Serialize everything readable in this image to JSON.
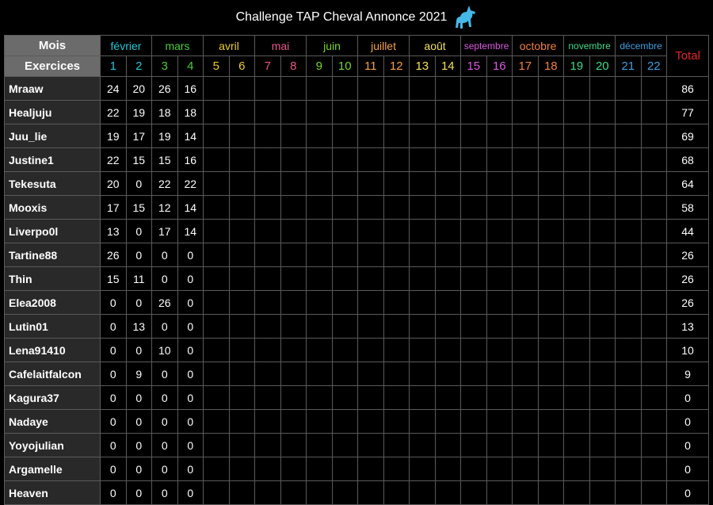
{
  "title": "Challenge TAP Cheval Annonce 2021",
  "title_icon": "unicorn-icon",
  "header": {
    "months_label": "Mois",
    "exercises_label": "Exercices",
    "total_label": "Total"
  },
  "months": [
    {
      "name": "février",
      "color": "#22c6d6"
    },
    {
      "name": "mars",
      "color": "#4ccd3c"
    },
    {
      "name": "avril",
      "color": "#e9cc2a"
    },
    {
      "name": "mai",
      "color": "#e9558c"
    },
    {
      "name": "juin",
      "color": "#74d42b"
    },
    {
      "name": "juillet",
      "color": "#f0a14a"
    },
    {
      "name": "août",
      "color": "#f1e05a"
    },
    {
      "name": "septembre",
      "color": "#d85ae0"
    },
    {
      "name": "octobre",
      "color": "#f27f3d"
    },
    {
      "name": "novembre",
      "color": "#3fd98a"
    },
    {
      "name": "décembre",
      "color": "#3f9ee0"
    }
  ],
  "exercises": [
    "1",
    "2",
    "3",
    "4",
    "5",
    "6",
    "7",
    "8",
    "9",
    "10",
    "11",
    "12",
    "13",
    "14",
    "15",
    "16",
    "17",
    "18",
    "19",
    "20",
    "21",
    "22"
  ],
  "rows": [
    {
      "name": "Mraaw",
      "scores": [
        "24",
        "20",
        "26",
        "16"
      ],
      "total": "86"
    },
    {
      "name": "Healjuju",
      "scores": [
        "22",
        "19",
        "18",
        "18"
      ],
      "total": "77"
    },
    {
      "name": "Juu_lie",
      "scores": [
        "19",
        "17",
        "19",
        "14"
      ],
      "total": "69"
    },
    {
      "name": "Justine1",
      "scores": [
        "22",
        "15",
        "15",
        "16"
      ],
      "total": "68"
    },
    {
      "name": "Tekesuta",
      "scores": [
        "20",
        "0",
        "22",
        "22"
      ],
      "total": "64"
    },
    {
      "name": "Mooxis",
      "scores": [
        "17",
        "15",
        "12",
        "14"
      ],
      "total": "58"
    },
    {
      "name": "Liverpo0l",
      "scores": [
        "13",
        "0",
        "17",
        "14"
      ],
      "total": "44"
    },
    {
      "name": "Tartine88",
      "scores": [
        "26",
        "0",
        "0",
        "0"
      ],
      "total": "26"
    },
    {
      "name": "Thin",
      "scores": [
        "15",
        "11",
        "0",
        "0"
      ],
      "total": "26"
    },
    {
      "name": "Elea2008",
      "scores": [
        "0",
        "0",
        "26",
        "0"
      ],
      "total": "26"
    },
    {
      "name": "Lutin01",
      "scores": [
        "0",
        "13",
        "0",
        "0"
      ],
      "total": "13"
    },
    {
      "name": "Lena91410",
      "scores": [
        "0",
        "0",
        "10",
        "0"
      ],
      "total": "10"
    },
    {
      "name": "Cafelaitfalcon",
      "scores": [
        "0",
        "9",
        "0",
        "0"
      ],
      "total": "9"
    },
    {
      "name": "Kagura37",
      "scores": [
        "0",
        "0",
        "0",
        "0"
      ],
      "total": "0"
    },
    {
      "name": "Nadaye",
      "scores": [
        "0",
        "0",
        "0",
        "0"
      ],
      "total": "0"
    },
    {
      "name": "Yoyojulian",
      "scores": [
        "0",
        "0",
        "0",
        "0"
      ],
      "total": "0"
    },
    {
      "name": "Argamelle",
      "scores": [
        "0",
        "0",
        "0",
        "0"
      ],
      "total": "0"
    },
    {
      "name": "Heaven",
      "scores": [
        "0",
        "0",
        "0",
        "0"
      ],
      "total": "0"
    }
  ]
}
